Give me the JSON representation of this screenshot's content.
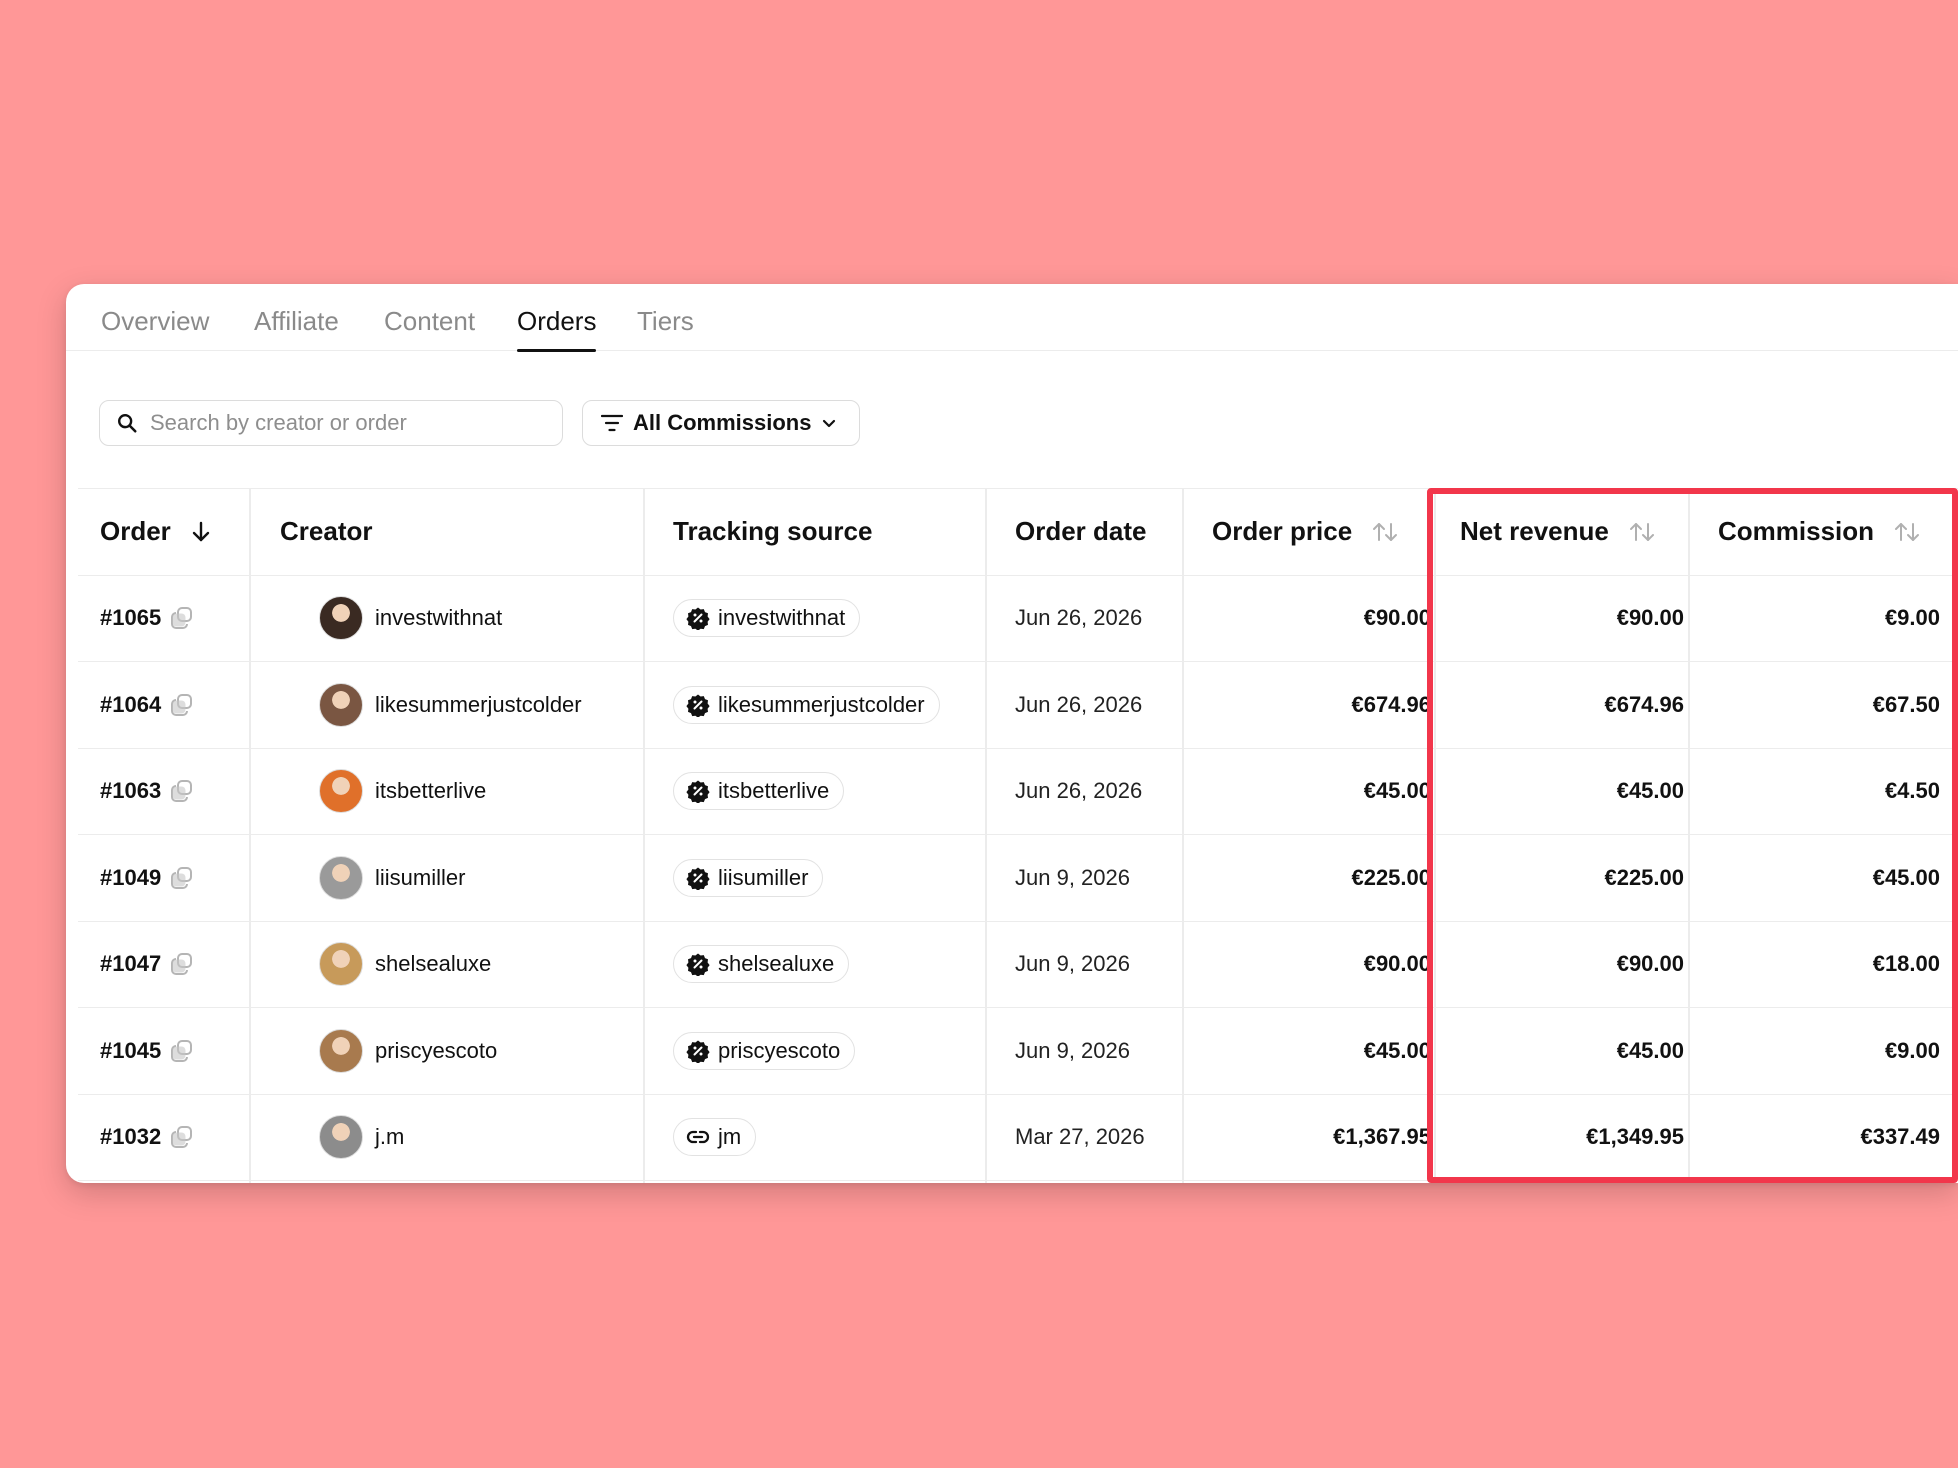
{
  "tabs": [
    {
      "label": "Overview",
      "active": false
    },
    {
      "label": "Affiliate",
      "active": false
    },
    {
      "label": "Content",
      "active": false
    },
    {
      "label": "Orders",
      "active": true
    },
    {
      "label": "Tiers",
      "active": false
    }
  ],
  "search": {
    "placeholder": "Search by creator or order",
    "value": ""
  },
  "filter": {
    "label": "All Commissions"
  },
  "table": {
    "headers": {
      "order": "Order",
      "creator": "Creator",
      "tracking": "Tracking source",
      "date": "Order date",
      "price": "Order price",
      "net": "Net revenue",
      "commission": "Commission"
    },
    "rows": [
      {
        "order": "#1065",
        "creator": "investwithnat",
        "source": "investwithnat",
        "source_type": "coupon",
        "date": "Jun 26, 2026",
        "price": "€90.00",
        "net": "€90.00",
        "commission": "€9.00",
        "avatar_color": "#3a2a22"
      },
      {
        "order": "#1064",
        "creator": "likesummerjustcolder",
        "source": "likesummerjustcolder",
        "source_type": "coupon",
        "date": "Jun 26, 2026",
        "price": "€674.96",
        "net": "€674.96",
        "commission": "€67.50",
        "avatar_color": "#7a5642"
      },
      {
        "order": "#1063",
        "creator": "itsbetterlive",
        "source": "itsbetterlive",
        "source_type": "coupon",
        "date": "Jun 26, 2026",
        "price": "€45.00",
        "net": "€45.00",
        "commission": "€4.50",
        "avatar_color": "#e0702a"
      },
      {
        "order": "#1049",
        "creator": "liisumiller",
        "source": "liisumiller",
        "source_type": "coupon",
        "date": "Jun 9, 2026",
        "price": "€225.00",
        "net": "€225.00",
        "commission": "€45.00",
        "avatar_color": "#9a9a9a"
      },
      {
        "order": "#1047",
        "creator": "shelsealuxe",
        "source": "shelsealuxe",
        "source_type": "coupon",
        "date": "Jun 9, 2026",
        "price": "€90.00",
        "net": "€90.00",
        "commission": "€18.00",
        "avatar_color": "#c79a5a"
      },
      {
        "order": "#1045",
        "creator": "priscyescoto",
        "source": "priscyescoto",
        "source_type": "coupon",
        "date": "Jun 9, 2026",
        "price": "€45.00",
        "net": "€45.00",
        "commission": "€9.00",
        "avatar_color": "#a87a4e"
      },
      {
        "order": "#1032",
        "creator": "j.m",
        "source": "jm",
        "source_type": "link",
        "date": "Mar 27, 2026",
        "price": "€1,367.95",
        "net": "€1,349.95",
        "commission": "€337.49",
        "avatar_color": "#8c8c8c"
      }
    ]
  },
  "highlight_color": "#f2364b",
  "background_color": "#ff9797"
}
